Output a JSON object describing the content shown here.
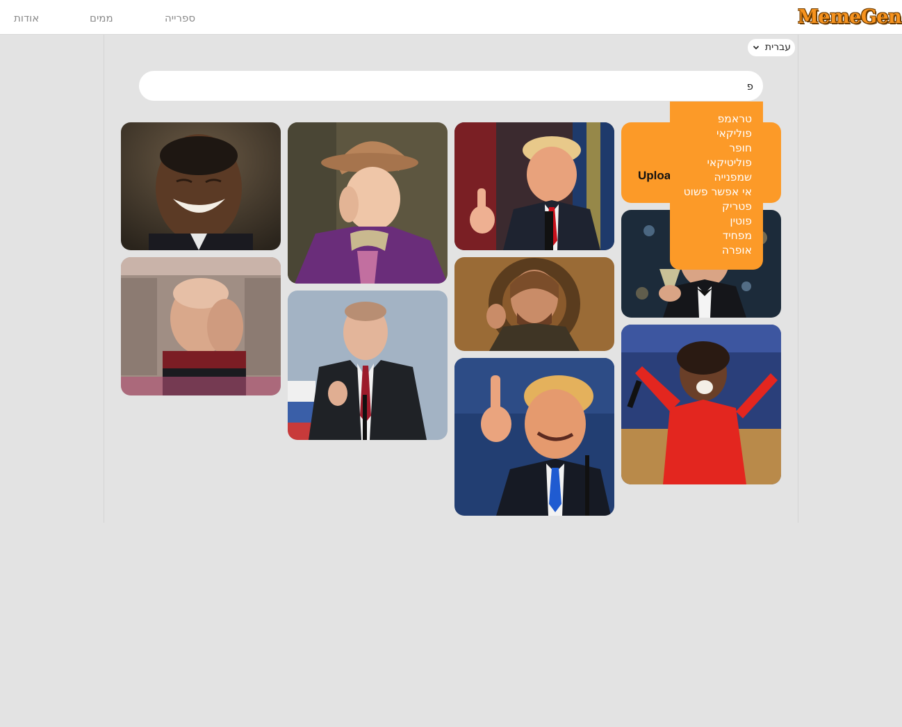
{
  "app": {
    "logo_text": "MemeGen"
  },
  "nav": {
    "about": "אודות",
    "memes": "ממים",
    "library": "ספרייה"
  },
  "language": {
    "selected": "עברית",
    "chevron_icon": "chevron-down-icon"
  },
  "search": {
    "value": "פ",
    "placeholder": ""
  },
  "autocomplete": {
    "options": [
      "טראמפ",
      "פוליקאי",
      "חופר",
      "פוליטיקאי",
      "שמפנייה",
      "אי אפשר פשוט",
      "פטריק",
      "פוטין",
      "מפחיד",
      "אופרה"
    ]
  },
  "upload_tile": {
    "label": "Upload",
    "color": "#fc9a28"
  },
  "gallery": [
    {
      "subject": "laughing man in suit"
    },
    {
      "subject": "man with purple coat and top hat"
    },
    {
      "subject": "man pointing at podium"
    },
    {
      "subject": "man in starship uniform facepalm"
    },
    {
      "subject": "man in dark suit at podium"
    },
    {
      "subject": "bearded man gesturing"
    },
    {
      "subject": "man raising glass of champagne"
    },
    {
      "subject": "man pointing, angry face"
    },
    {
      "subject": "woman in red dress with microphone"
    }
  ],
  "colors": {
    "accent": "#fc9a28",
    "background": "#e3e3e3",
    "header": "#ffffff"
  }
}
